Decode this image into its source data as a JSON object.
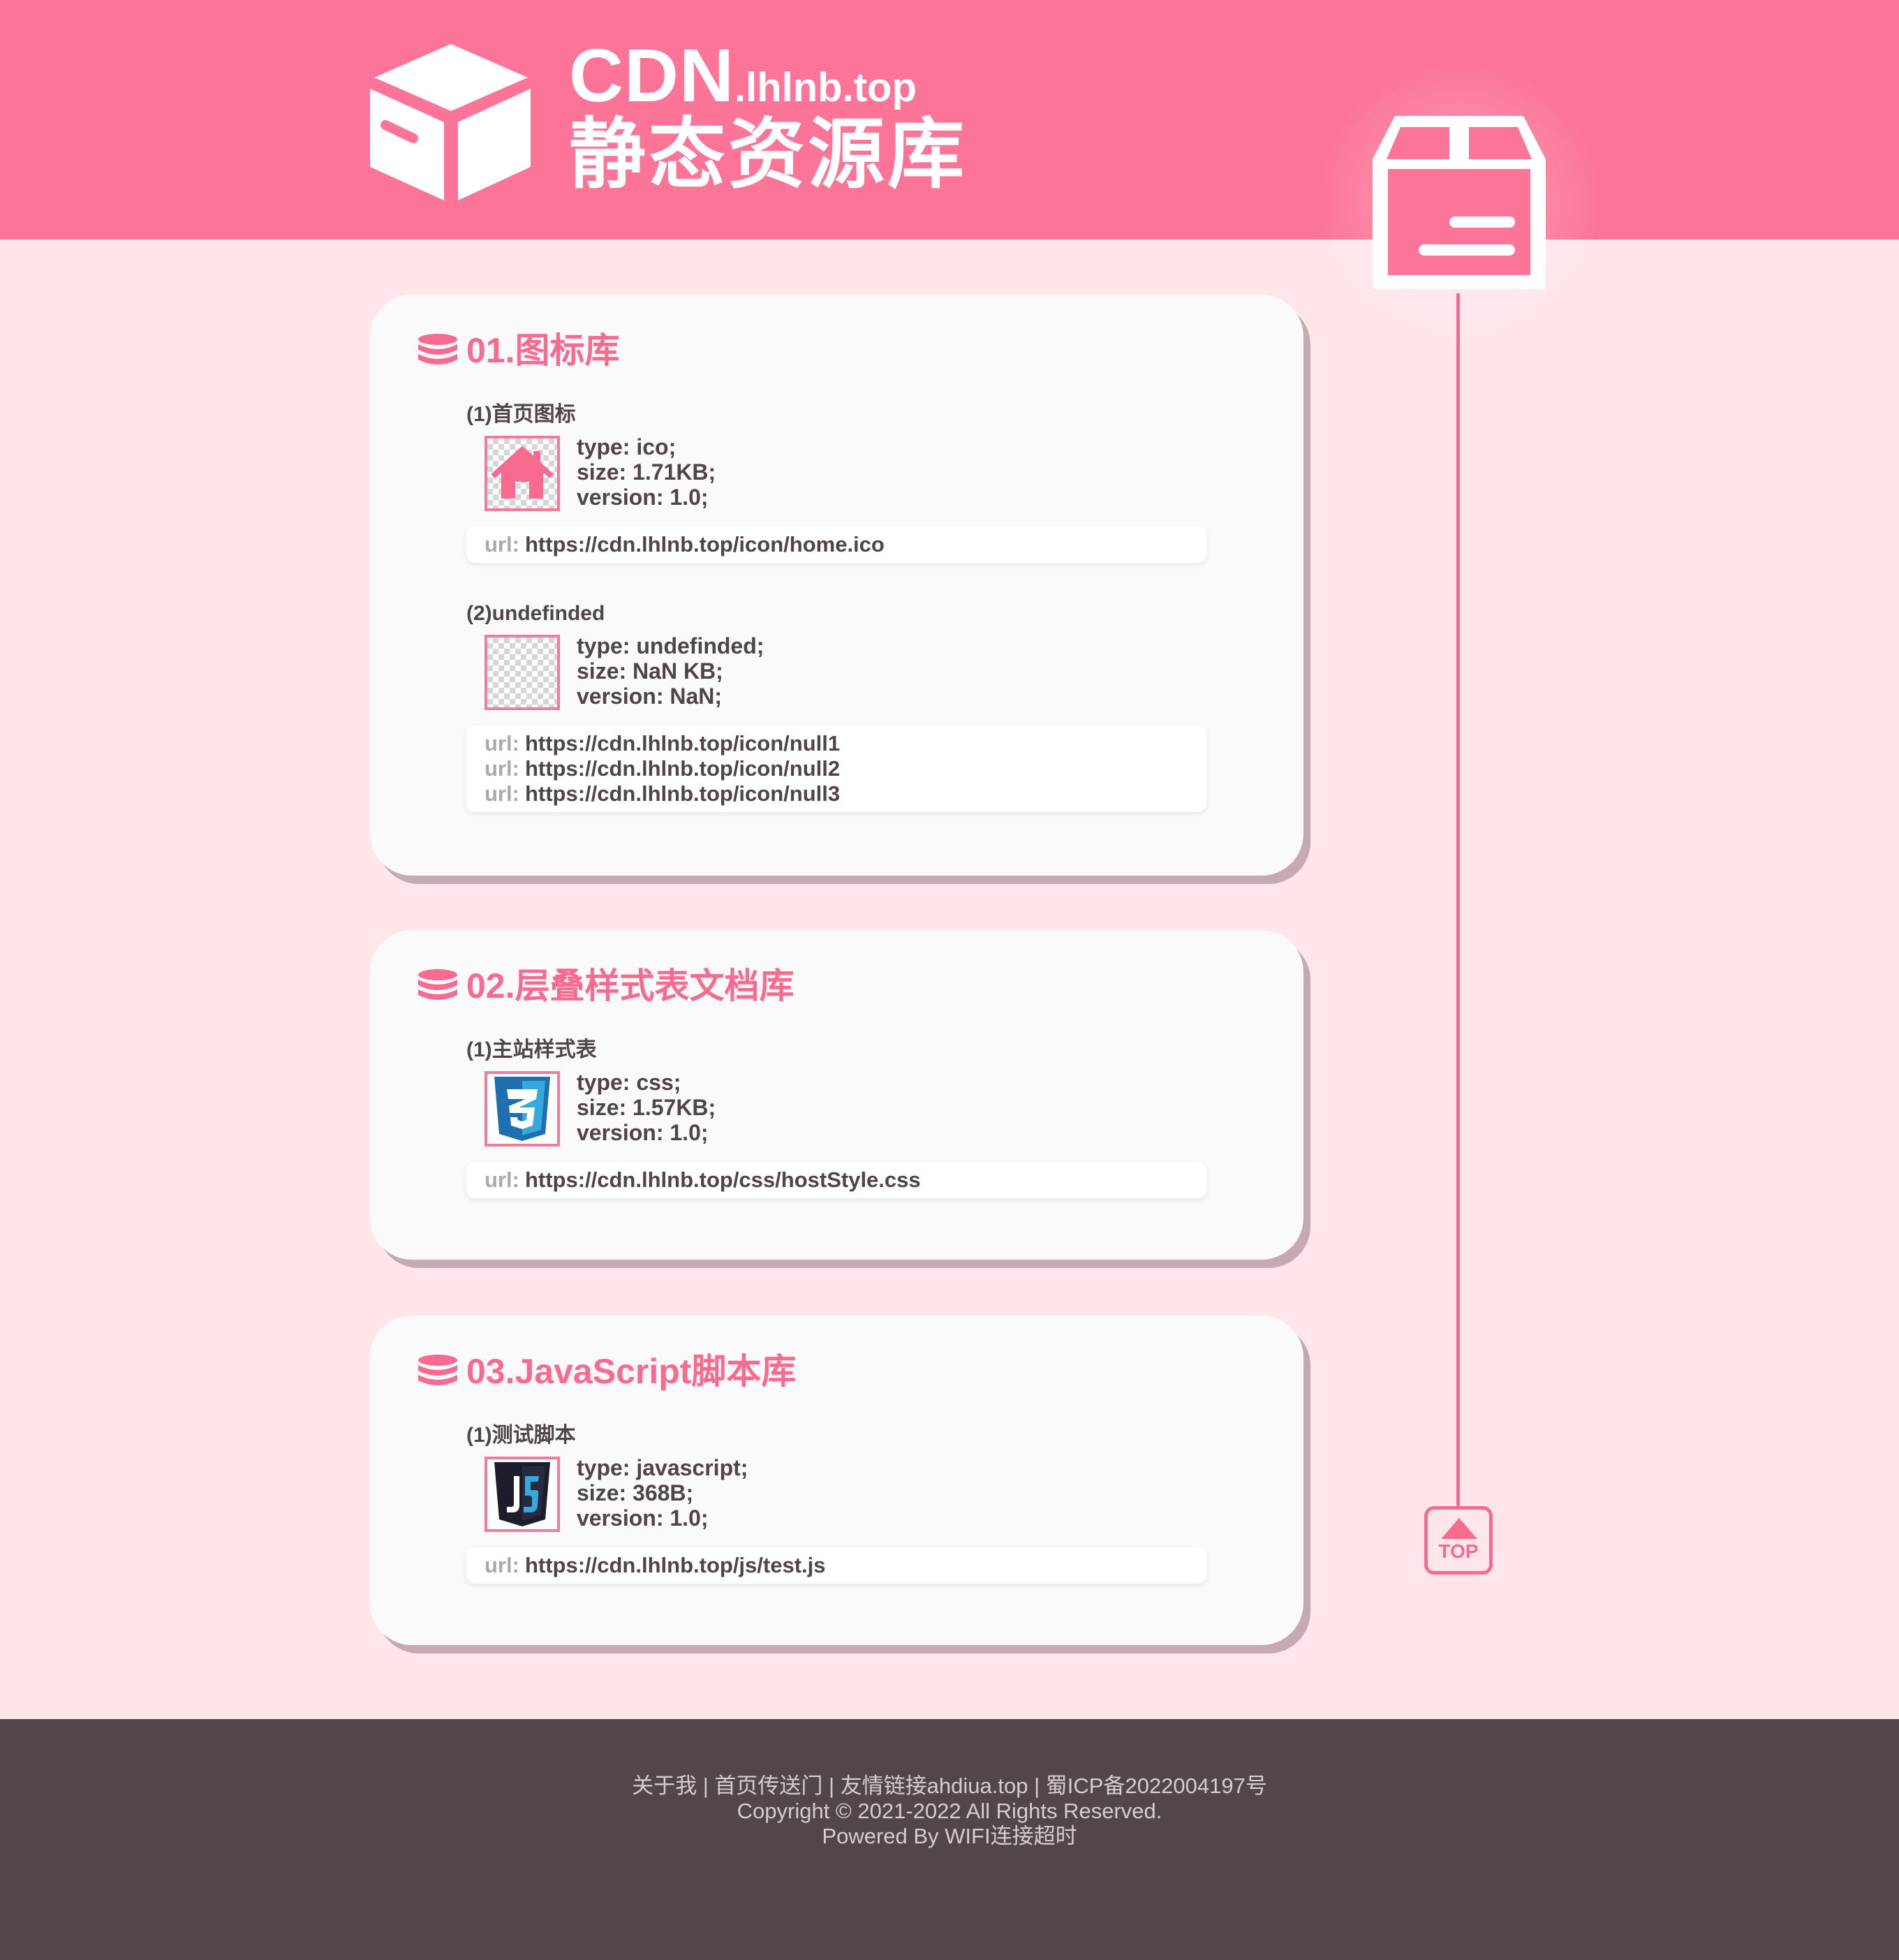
{
  "header": {
    "brand_main": "CDN",
    "brand_domain": ".lhlnb.top",
    "subtitle": "静态资源库"
  },
  "top_button": {
    "label": "TOP"
  },
  "sections": [
    {
      "title": "01.图标库",
      "items": [
        {
          "title": "(1)首页图标",
          "type_line": "type: ico;",
          "size_line": "size: 1.71KB;",
          "version_line": "version: 1.0;",
          "icon": "home-icon",
          "urls": [
            {
              "prefix": "url:",
              "value": "https://cdn.lhlnb.top/icon/home.ico"
            }
          ]
        },
        {
          "title": "(2)undefinded",
          "type_line": "type: undefinded;",
          "size_line": "size: NaN KB;",
          "version_line": "version: NaN;",
          "icon": "transparent-placeholder-icon",
          "urls": [
            {
              "prefix": "url:",
              "value": "https://cdn.lhlnb.top/icon/null1"
            },
            {
              "prefix": "url:",
              "value": "https://cdn.lhlnb.top/icon/null2"
            },
            {
              "prefix": "url:",
              "value": "https://cdn.lhlnb.top/icon/null3"
            }
          ]
        }
      ]
    },
    {
      "title": "02.层叠样式表文档库",
      "items": [
        {
          "title": "(1)主站样式表",
          "type_line": "type: css;",
          "size_line": "size: 1.57KB;",
          "version_line": "version: 1.0;",
          "icon": "css3-icon",
          "urls": [
            {
              "prefix": "url:",
              "value": "https://cdn.lhlnb.top/css/hostStyle.css"
            }
          ]
        }
      ]
    },
    {
      "title": "03.JavaScript脚本库",
      "items": [
        {
          "title": "(1)测试脚本",
          "type_line": "type: javascript;",
          "size_line": "size: 368B;",
          "version_line": "version: 1.0;",
          "icon": "js-icon",
          "urls": [
            {
              "prefix": "url:",
              "value": "https://cdn.lhlnb.top/js/test.js"
            }
          ]
        }
      ]
    }
  ],
  "footer": {
    "links": [
      "关于我",
      "首页传送门",
      "友情链接ahdiua.top",
      "蜀ICP备2022004197号"
    ],
    "separator": " | ",
    "copyright": "Copyright © 2021-2022 All Rights Reserved.",
    "powered": "Powered By WIFI连接超时"
  },
  "colors": {
    "header_pink": "#fc7497",
    "accent_pink": "#f76b91",
    "page_background": "#ffe6eb",
    "card_background": "#fafafa",
    "text_dark": "#4f4448",
    "footer_background": "#52464b"
  }
}
